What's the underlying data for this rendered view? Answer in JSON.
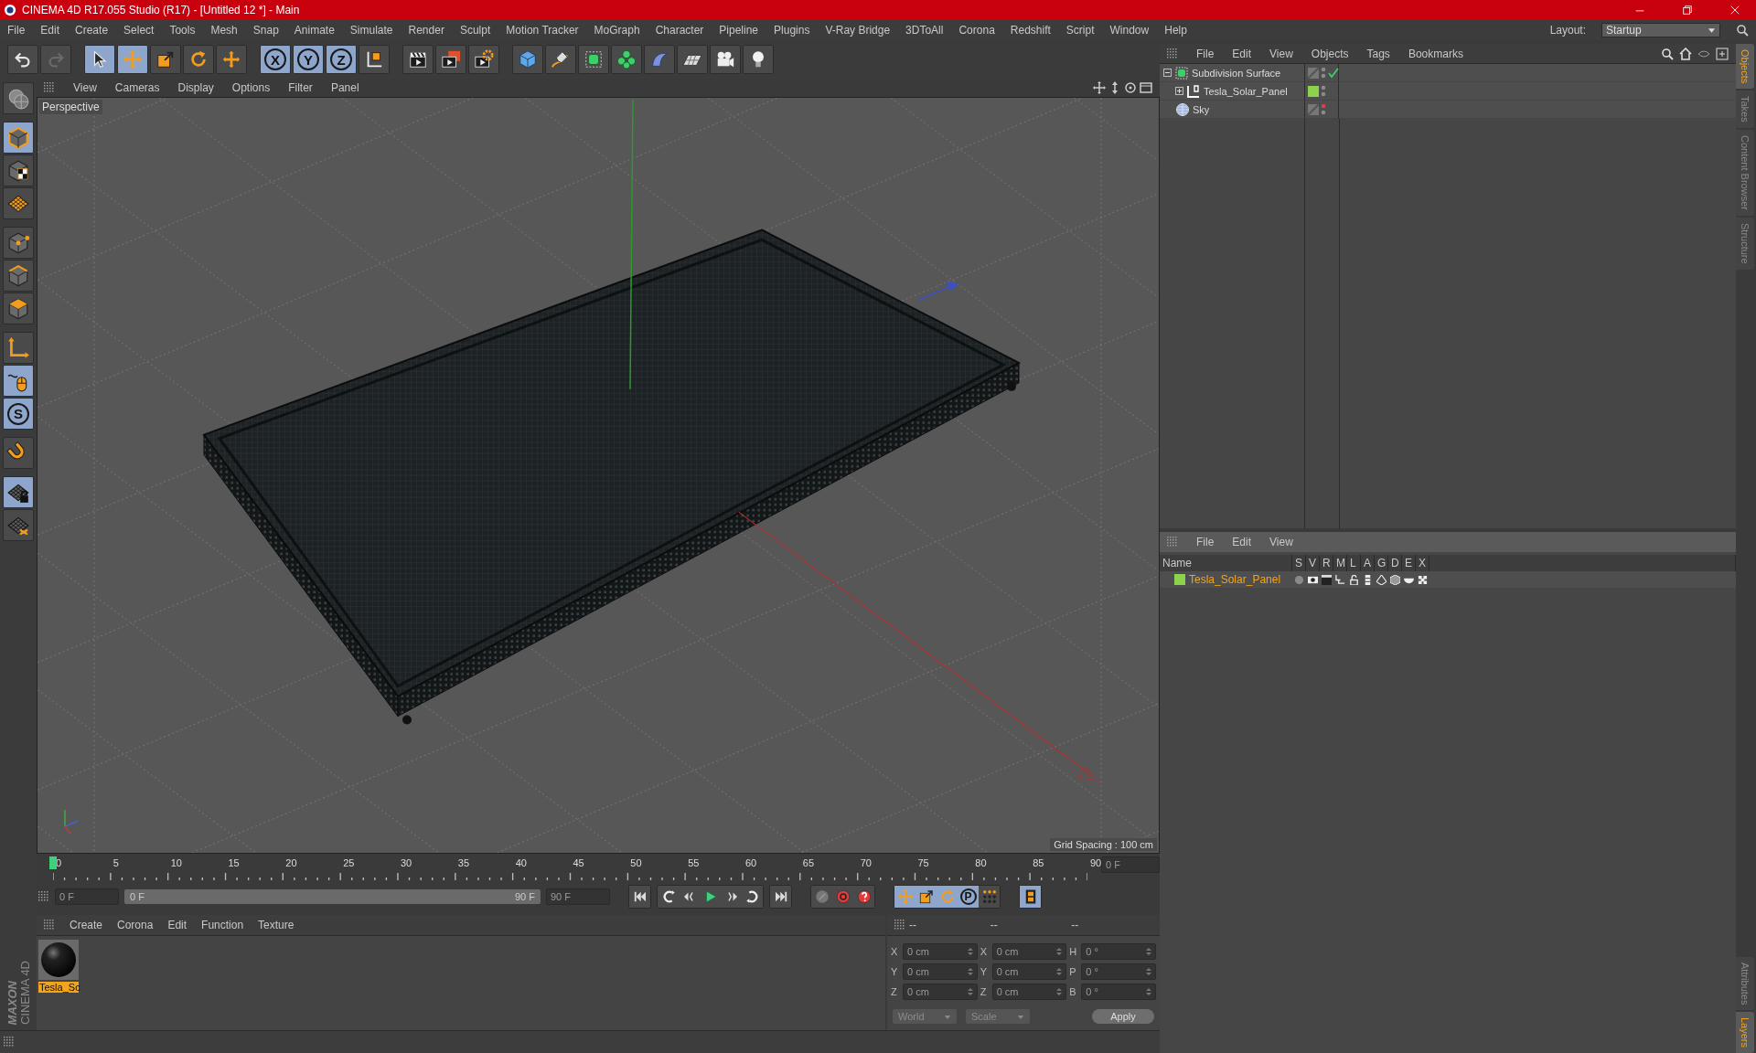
{
  "window": {
    "title": "CINEMA 4D R17.055 Studio (R17) - [Untitled 12 *] - Main"
  },
  "menu": [
    "File",
    "Edit",
    "Create",
    "Select",
    "Tools",
    "Mesh",
    "Snap",
    "Animate",
    "Simulate",
    "Render",
    "Sculpt",
    "Motion Tracker",
    "MoGraph",
    "Character",
    "Pipeline",
    "Plugins",
    "V-Ray Bridge",
    "3DToAll",
    "Corona",
    "Redshift",
    "Script",
    "Window",
    "Help"
  ],
  "layout": {
    "label": "Layout:",
    "value": "Startup"
  },
  "toolbar": [
    [
      {
        "selected": false
      },
      {
        "selected": false
      }
    ],
    [
      {
        "selected": true
      },
      {
        "selected": true
      },
      {
        "selected": false
      },
      {
        "selected": false
      },
      {
        "selected": false
      }
    ],
    [
      {
        "label": "X",
        "selected": true
      },
      {
        "label": "Y",
        "selected": true
      },
      {
        "label": "Z",
        "selected": true
      },
      {
        "selected": false
      }
    ],
    [
      {
        "selected": false
      },
      {
        "selected": false
      },
      {
        "selected": false
      }
    ],
    [
      {
        "selected": false
      },
      {
        "selected": false
      },
      {
        "selected": false
      },
      {
        "selected": false
      },
      {
        "selected": false
      },
      {
        "selected": false
      },
      {
        "selected": false
      },
      {
        "selected": false
      }
    ]
  ],
  "left_tools": [
    [
      {
        "selected": false
      }
    ],
    [
      {
        "selected": true
      },
      {
        "selected": false
      },
      {
        "selected": false
      }
    ],
    [
      {
        "selected": false
      },
      {
        "selected": false
      },
      {
        "selected": false
      }
    ],
    [
      {
        "selected": false
      },
      {
        "selected": true
      },
      {
        "label": "S",
        "selected": true
      }
    ],
    [
      {
        "selected": false
      }
    ],
    [
      {
        "selected": true
      },
      {
        "selected": false
      }
    ]
  ],
  "logo": {
    "brand": "MAXON",
    "product": "CINEMA 4D"
  },
  "viewport": {
    "menu": [
      "View",
      "Cameras",
      "Display",
      "Options",
      "Filter",
      "Panel"
    ],
    "camera": "Perspective",
    "grid_spacing": "Grid Spacing : 100 cm"
  },
  "timeline": {
    "ticks": [
      "0",
      "5",
      "10",
      "15",
      "20",
      "25",
      "30",
      "35",
      "40",
      "45",
      "50",
      "55",
      "60",
      "65",
      "70",
      "75",
      "80",
      "85",
      "90"
    ],
    "level": 0,
    "current_frame": "0 F",
    "start": "0 F",
    "range_start": "0 F",
    "range_end": "90 F",
    "range": {
      "level": 1
    },
    "end": "90 F",
    "key_tools": [
      {
        "selected": true
      },
      {
        "selected": true
      },
      {
        "selected": true
      },
      {
        "label": "P",
        "selected": true
      },
      {
        "selected": false
      }
    ],
    "film_selected": true
  },
  "materials": {
    "menu": [
      "Create",
      "Corona",
      "Edit",
      "Function",
      "Texture"
    ],
    "items": [
      {
        "name": "Tesla_Sc",
        "selected": true
      }
    ]
  },
  "coordinates": {
    "headers": [
      "--",
      "--",
      "--"
    ],
    "rows": [
      {
        "axis": "X",
        "position": "0 cm",
        "size_axis": "X",
        "size": "0 cm",
        "rot_axis": "H",
        "rotation": "0 °"
      },
      {
        "axis": "Y",
        "position": "0 cm",
        "size_axis": "Y",
        "size": "0 cm",
        "rot_axis": "P",
        "rotation": "0 °"
      },
      {
        "axis": "Z",
        "position": "0 cm",
        "size_axis": "Z",
        "size": "0 cm",
        "rot_axis": "B",
        "rotation": "0 °"
      }
    ],
    "mode": "World",
    "size_mode": "Scale",
    "apply": "Apply"
  },
  "objects": {
    "menu": [
      "File",
      "Edit",
      "View",
      "Objects",
      "Tags",
      "Bookmarks"
    ],
    "tree": [
      {
        "name": "Subdivision Surface",
        "kind": "subdivision",
        "expanded": true,
        "enabled": true,
        "editor_off": false,
        "children": [
          {
            "name": "Tesla_Solar_Panel",
            "kind": "polygon",
            "expanded": false,
            "color": "#8cd24a",
            "editor_off": false
          }
        ]
      },
      {
        "name": "Sky",
        "kind": "sky",
        "editor_off": true
      }
    ]
  },
  "layers": {
    "menu": [
      "File",
      "Edit",
      "View"
    ],
    "columns": [
      "Name",
      "S",
      "V",
      "R",
      "M",
      "L",
      "A",
      "G",
      "D",
      "E",
      "X"
    ],
    "rows": [
      {
        "name": "Tesla_Solar_Panel",
        "color": "#8cd24a"
      }
    ]
  },
  "side_tabs": [
    {
      "label": "Objects",
      "selected": true
    },
    {
      "label": "Takes",
      "selected": false
    },
    {
      "label": "Content Browser",
      "selected": false
    },
    {
      "label": "Structure",
      "selected": false
    }
  ],
  "side_tabs_lower": [
    {
      "label": "Attributes",
      "selected": false
    },
    {
      "label": "Layers",
      "selected": true
    }
  ]
}
